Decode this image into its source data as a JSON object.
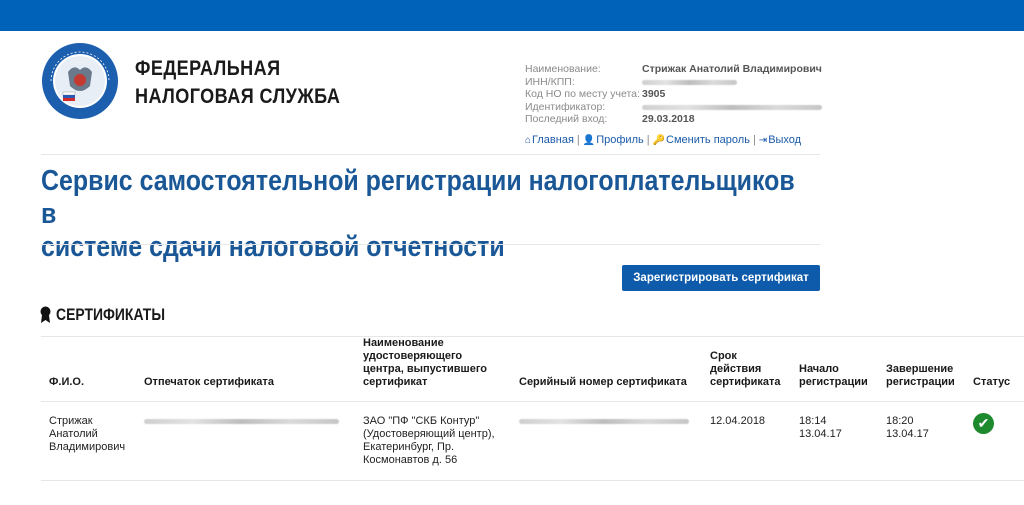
{
  "colors": {
    "topbar": "#0062b8",
    "title": "#1a5796",
    "button": "#0e5bab",
    "status_ok": "#1e8a2e",
    "link": "#1a5aa8"
  },
  "brand": {
    "line1": "ФЕДЕРАЛЬНАЯ",
    "line2": "НАЛОГОВАЯ СЛУЖБА",
    "logo_icon": "fns-emblem-icon"
  },
  "user_info": {
    "name_label": "Наименование:",
    "name_value": "Стрижак Анатолий Владимирович",
    "inn_label": "ИНН/КПП:",
    "kod_label": "Код НО по месту учета:",
    "kod_value": "3905",
    "id_label": "Идентификатор:",
    "last_login_label": "Последний вход:",
    "last_login_value": "29.03.2018"
  },
  "nav": {
    "home": "Главная",
    "profile": "Профиль",
    "change_password": "Сменить пароль",
    "logout": "Выход"
  },
  "page_title": {
    "line1": "Сервис самостоятельной регистрации налогоплательщиков в",
    "line2": "системе сдачи налоговой отчетности"
  },
  "register_button": "Зарегистрировать сертификат",
  "section_title": "СЕРТИФИКАТЫ",
  "table": {
    "headers": {
      "fio": "Ф.И.О.",
      "thumbprint": "Отпечаток сертификата",
      "ca_name": "Наименование удостоверяющего центра, выпустившего сертификат",
      "serial": "Серийный номер сертификата",
      "validity": "Срок действия сертификата",
      "reg_start": "Начало регистрации",
      "reg_end": "Завершение регистрации",
      "status": "Статус"
    },
    "rows": [
      {
        "fio": "Стрижак Анатолий Владимирович",
        "ca_name": "ЗАО \"ПФ \"СКБ Контур\" (Удостоверяющий центр), Екатеринбург, Пр. Космонавтов д. 56",
        "validity": "12.04.2018",
        "reg_start_time": "18:14",
        "reg_start_date": "13.04.17",
        "reg_end_time": "18:20",
        "reg_end_date": "13.04.17",
        "status_icon": "check-circle-icon"
      }
    ]
  }
}
